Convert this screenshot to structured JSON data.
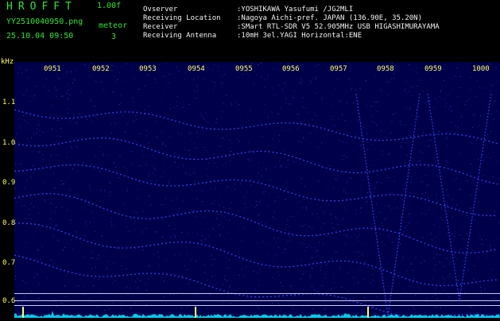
{
  "header": {
    "app_title": "HROFFT",
    "version": "1.00f",
    "file_name": "YY2510040950.png",
    "timestamp": "25.10.04 09:50",
    "mode_label": "meteor",
    "mode_value": "3"
  },
  "info": [
    {
      "label": "Ovserver",
      "value": ":YOSHIKAWA Yasufumi /JG2MLI"
    },
    {
      "label": "Receiving Location",
      "value": ":Nagoya Aichi-pref. JAPAN (136.90E, 35.20N)"
    },
    {
      "label": "Receiver",
      "value": ":SMart RTL-SDR V5 52.905MHz USB HIGASHIMURAYAMA"
    },
    {
      "label": "Receiving Antenna",
      "value": ":10mH 3el.YAGI Horizontal:ENE"
    }
  ],
  "axes": {
    "unit": "kHz",
    "freq_ticks": [
      "1.1",
      "1.0",
      "0.9",
      "0.8",
      "0.7",
      "0.6"
    ],
    "time_ticks": [
      "0951",
      "0952",
      "0953",
      "0954",
      "0955",
      "0956",
      "0957",
      "0958",
      "0959",
      "1000"
    ]
  },
  "colors": {
    "background": "#000000",
    "spectrum_bg": "#00004a",
    "signal": "#3a4cff",
    "trace": "#00e0ff",
    "marker": "#ffff66",
    "title_green": "#2ee52e"
  }
}
